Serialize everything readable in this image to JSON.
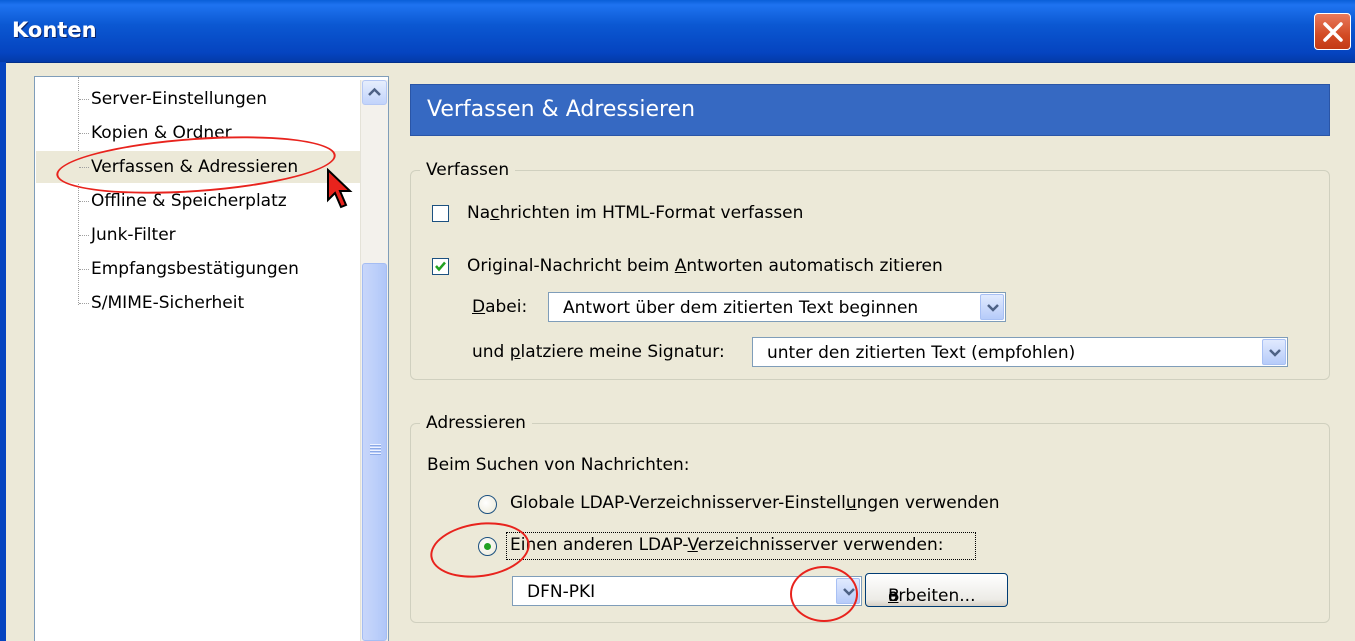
{
  "window": {
    "title": "Konten",
    "close_icon": "close-icon"
  },
  "tree": {
    "items": [
      {
        "label": "Server-Einstellungen"
      },
      {
        "label": "Kopien & Ordner"
      },
      {
        "label": "Verfassen & Adressieren",
        "selected": true
      },
      {
        "label": "Offline & Speicherplatz"
      },
      {
        "label": "Junk-Filter"
      },
      {
        "label": "Empfangsbestätigungen"
      },
      {
        "label": "S/MIME-Sicherheit"
      }
    ]
  },
  "page": {
    "header": "Verfassen & Adressieren"
  },
  "compose": {
    "group_label": "Verfassen",
    "html_format": {
      "label_pre": "Na",
      "label_u": "c",
      "label_post": "hrichten im HTML-Format verfassen",
      "checked": false
    },
    "quote_original": {
      "label_pre": "Original-Nachricht beim ",
      "label_u": "A",
      "label_post": "ntworten automatisch zitieren",
      "checked": true
    },
    "reply_position": {
      "label_u": "D",
      "label_post": "abei:",
      "value": "Antwort über dem zitierten Text beginnen"
    },
    "signature_position": {
      "label_pre": "und ",
      "label_u": "p",
      "label_post": "latziere meine Signatur:",
      "value": "unter den zitierten Text (empfohlen)"
    }
  },
  "addressing": {
    "group_label": "Adressieren",
    "intro": "Beim Suchen von Nachrichten:",
    "option_global": {
      "label_pre": "Globale LDAP-Verzeichnisserver-Einstell",
      "label_u": "u",
      "label_post": "ngen verwenden",
      "selected": false
    },
    "option_other": {
      "label_pre": "Einen anderen LDAP-",
      "label_u": "V",
      "label_post": "erzeichnisserver verwenden:",
      "selected": true
    },
    "server_value": "DFN-PKI",
    "edit_button": {
      "label_pre": "B",
      "label_u": "e",
      "label_post": "arbeiten..."
    }
  },
  "colors": {
    "titlebar": "#0544c0",
    "header": "#3669c2",
    "annotation": "#e8231d",
    "dialog_bg": "#ece9d8"
  }
}
